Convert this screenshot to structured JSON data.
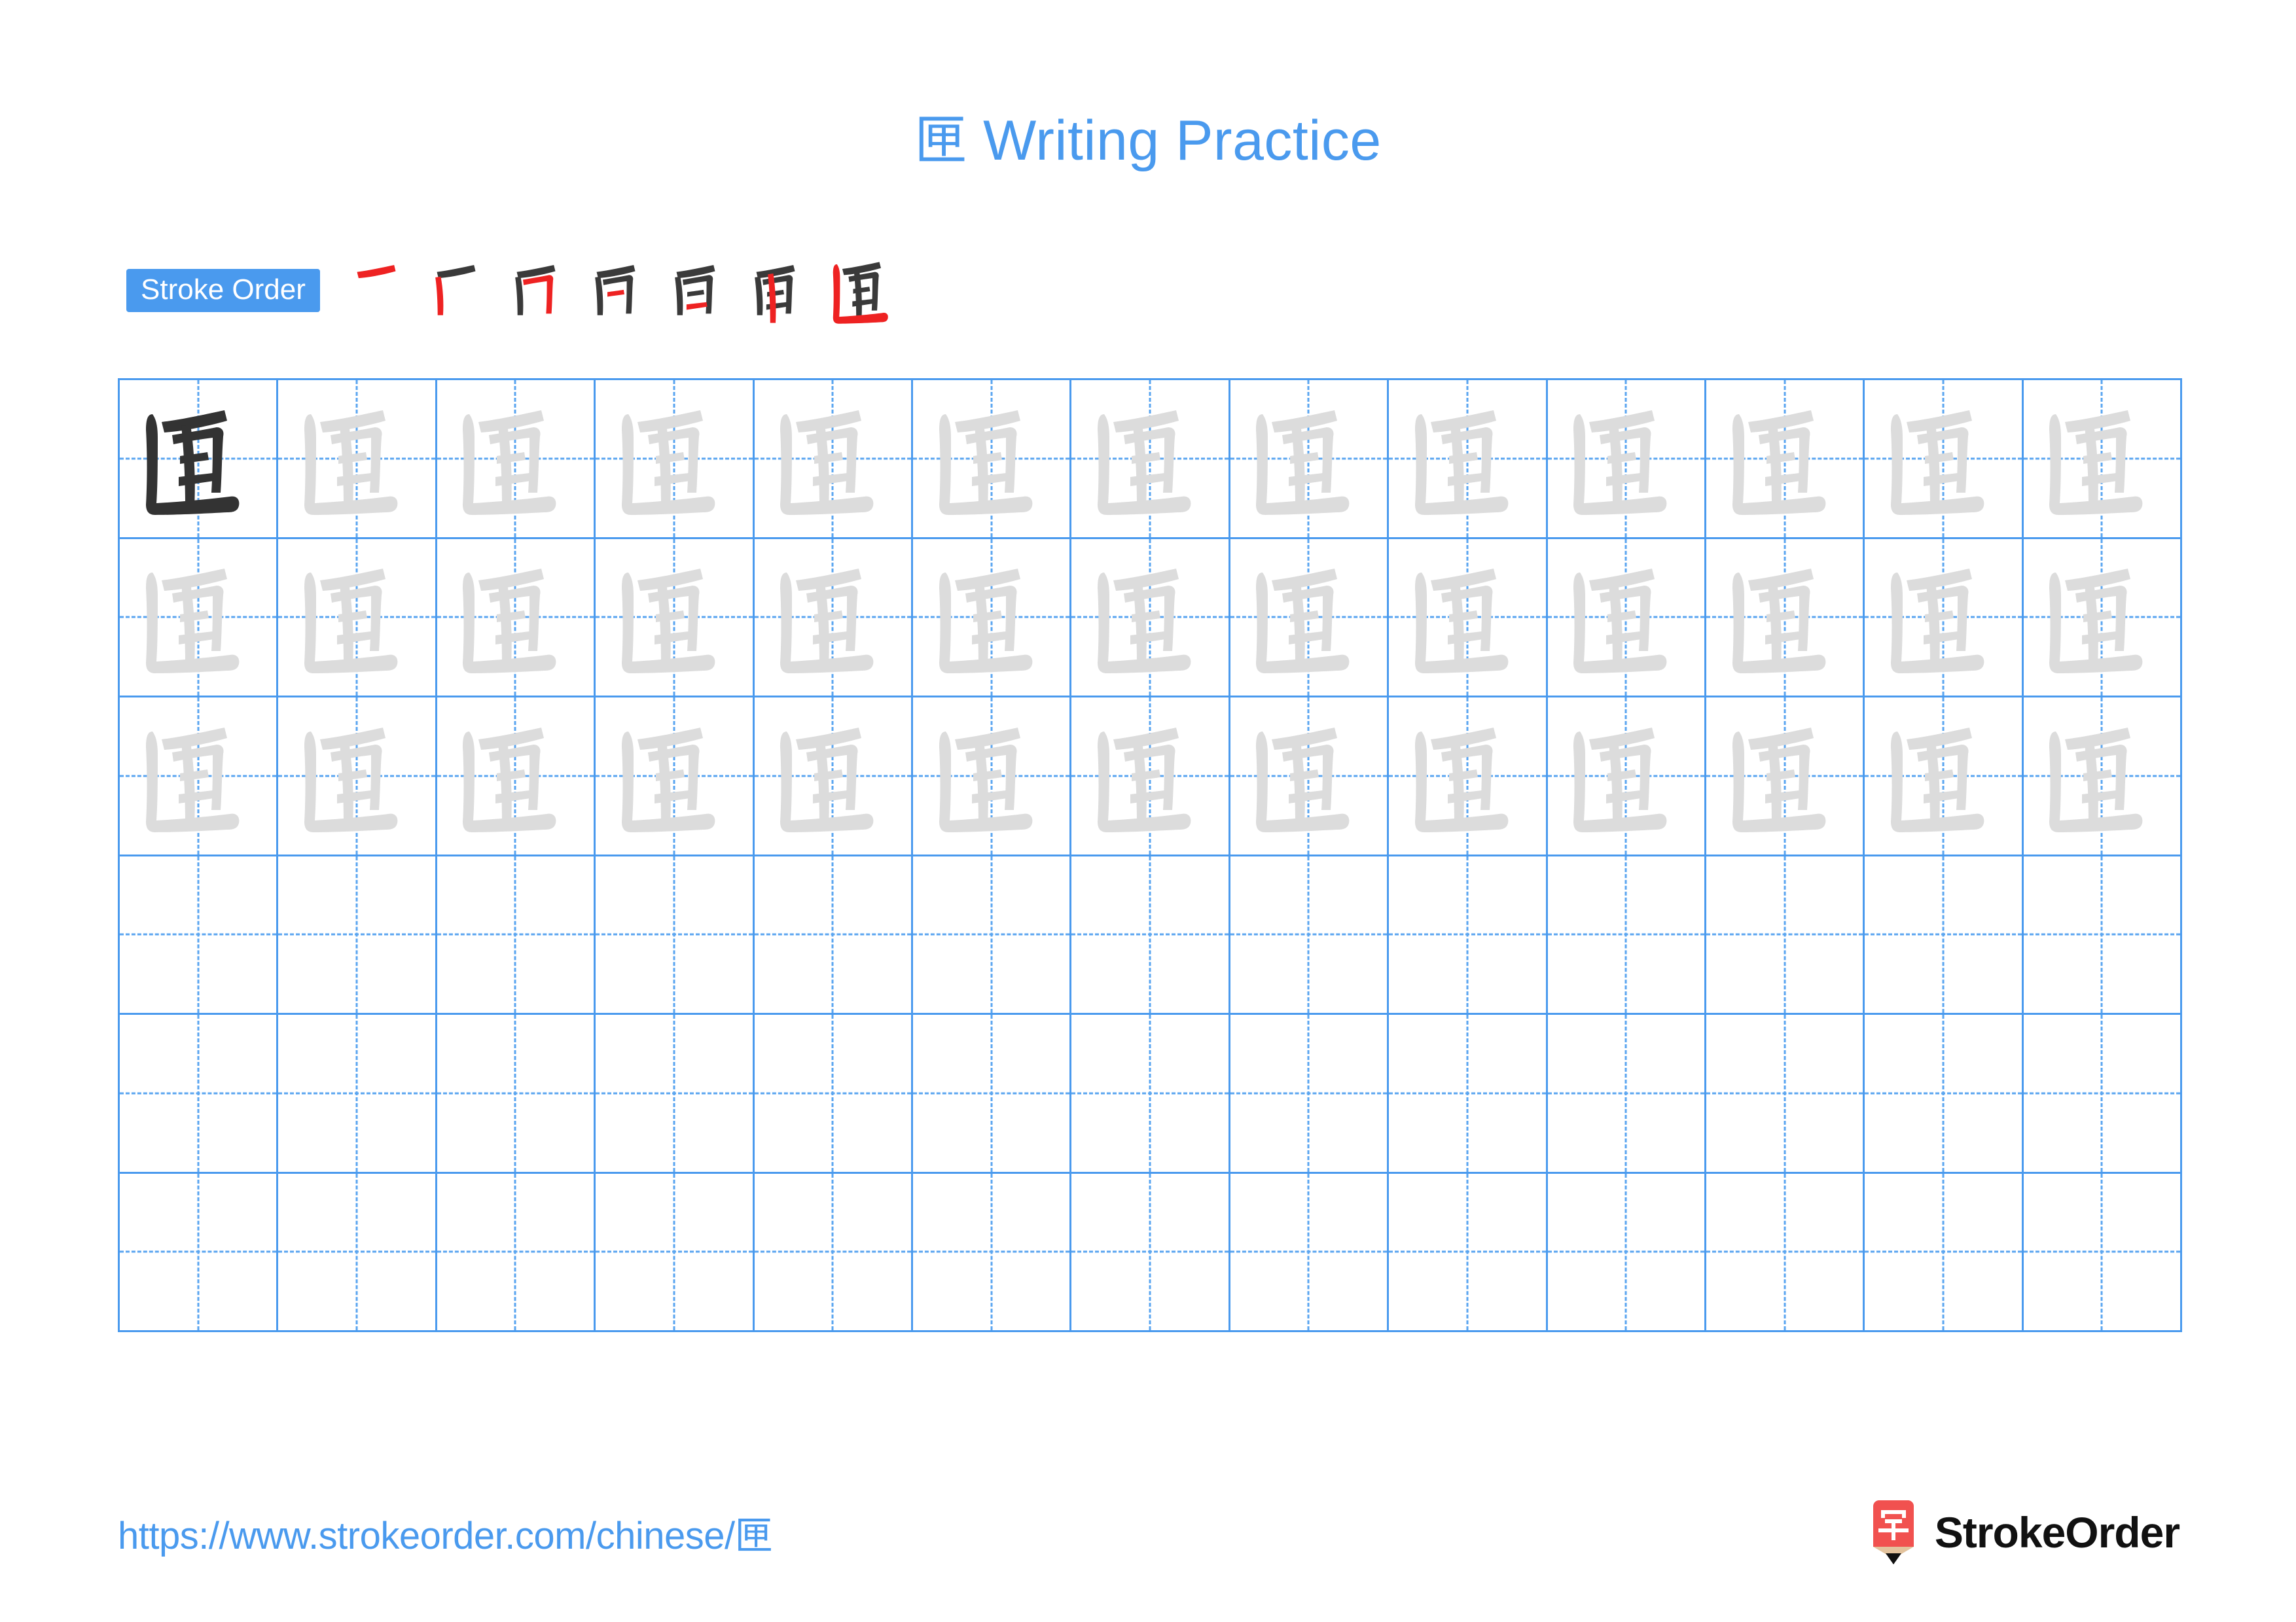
{
  "page": {
    "character": "匣",
    "title_suffix": " Writing Practice",
    "title_full": "匣 Writing Practice",
    "background_color": "#ffffff",
    "accent_color": "#4a9aee",
    "model_glyph_color": "#333333",
    "trace_glyph_color": "#dcdcdc",
    "stroke_new_color": "#ee2222",
    "stroke_done_color": "#3a3a3a"
  },
  "stroke_order": {
    "badge_label": "Stroke Order",
    "total_strokes": 7,
    "steps": [
      {
        "index": 1,
        "name": "stroke-step-1",
        "description": "heng (horizontal top stroke)"
      },
      {
        "index": 2,
        "name": "stroke-step-2",
        "description": "shu (vertical left stroke)"
      },
      {
        "index": 3,
        "name": "stroke-step-3",
        "description": "heng-zhe-gou (horizontal turn hook)"
      },
      {
        "index": 4,
        "name": "stroke-step-4",
        "description": "heng (short inner horizontal)"
      },
      {
        "index": 5,
        "name": "stroke-step-5",
        "description": "heng (lower inner horizontal)"
      },
      {
        "index": 6,
        "name": "stroke-step-6",
        "description": "shu (center vertical through)"
      },
      {
        "index": 7,
        "name": "stroke-step-7",
        "description": "shu-zhe (enclosing left vertical and base)"
      }
    ]
  },
  "practice_grid": {
    "columns": 13,
    "rows": 6,
    "rows_with_characters": 3,
    "empty_rows": 3,
    "cell_types": [
      [
        "model",
        "trace",
        "trace",
        "trace",
        "trace",
        "trace",
        "trace",
        "trace",
        "trace",
        "trace",
        "trace",
        "trace",
        "trace"
      ],
      [
        "trace",
        "trace",
        "trace",
        "trace",
        "trace",
        "trace",
        "trace",
        "trace",
        "trace",
        "trace",
        "trace",
        "trace",
        "trace"
      ],
      [
        "trace",
        "trace",
        "trace",
        "trace",
        "trace",
        "trace",
        "trace",
        "trace",
        "trace",
        "trace",
        "trace",
        "trace",
        "trace"
      ],
      [
        "empty",
        "empty",
        "empty",
        "empty",
        "empty",
        "empty",
        "empty",
        "empty",
        "empty",
        "empty",
        "empty",
        "empty",
        "empty"
      ],
      [
        "empty",
        "empty",
        "empty",
        "empty",
        "empty",
        "empty",
        "empty",
        "empty",
        "empty",
        "empty",
        "empty",
        "empty",
        "empty"
      ],
      [
        "empty",
        "empty",
        "empty",
        "empty",
        "empty",
        "empty",
        "empty",
        "empty",
        "empty",
        "empty",
        "empty",
        "empty",
        "empty"
      ]
    ]
  },
  "footer": {
    "url": "https://www.strokeorder.com/chinese/匣",
    "brand_name": "StrokeOrder",
    "brand_mark_character": "字",
    "brand_mark_color": "#f1514f",
    "brand_mark_tip_color": "#e3c39d"
  }
}
